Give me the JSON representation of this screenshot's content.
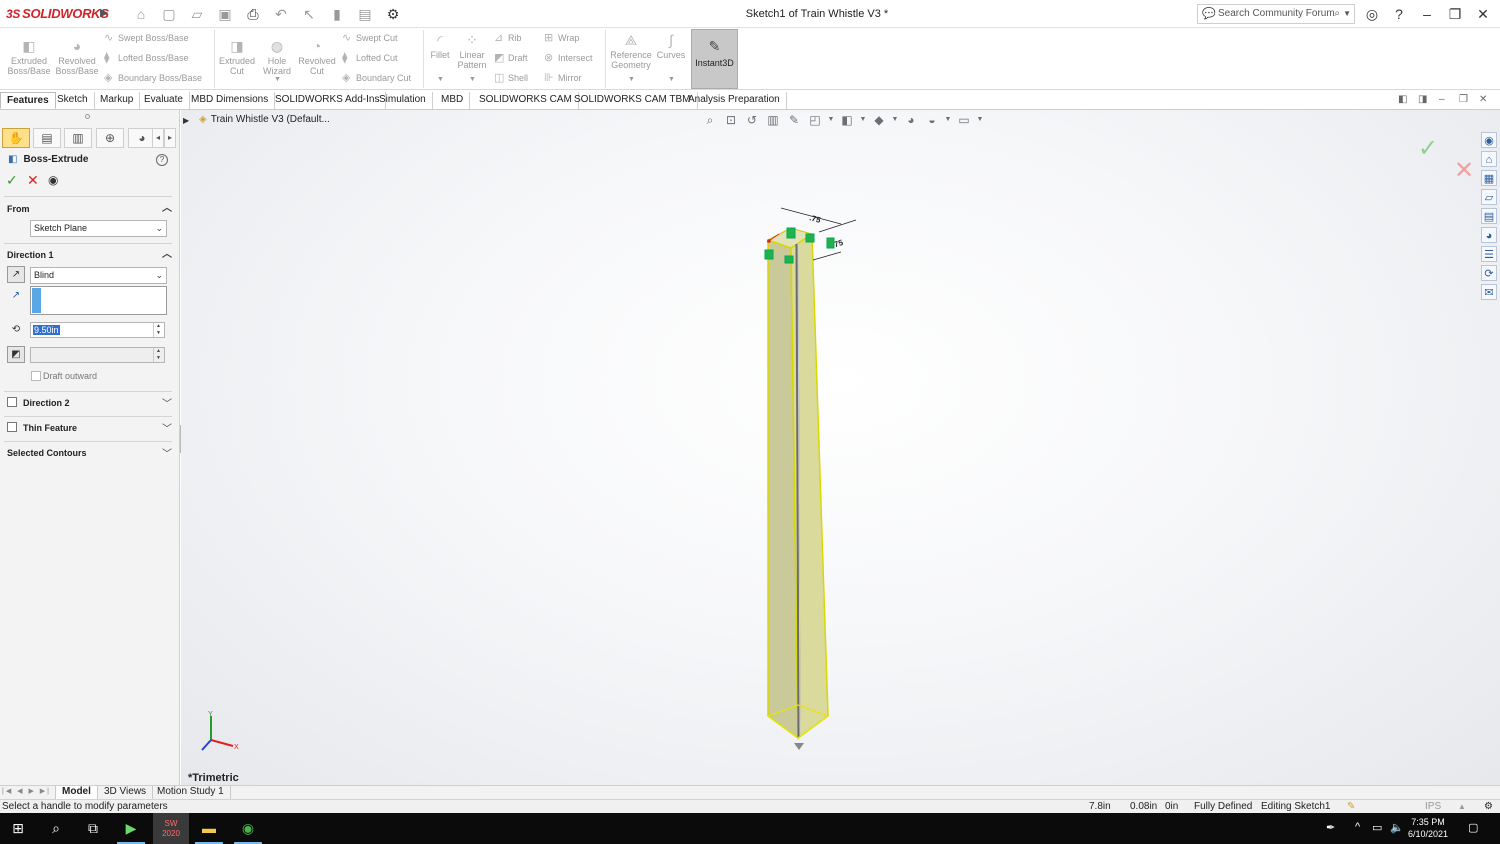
{
  "app": {
    "logo_ds": "3S",
    "logo_text": "SOLIDWORKS",
    "title": "Sketch1 of Train Whistle V3 *",
    "search_placeholder": "Search Community Forum"
  },
  "command_manager": {
    "extruded_boss": "Extruded Boss/Base",
    "revolved_boss": "Revolved Boss/Base",
    "swept_boss": "Swept Boss/Base",
    "lofted_boss": "Lofted Boss/Base",
    "boundary_boss": "Boundary Boss/Base",
    "extruded_cut": "Extruded Cut",
    "hole_wizard": "Hole Wizard",
    "revolved_cut": "Revolved Cut",
    "swept_cut": "Swept Cut",
    "lofted_cut": "Lofted Cut",
    "boundary_cut": "Boundary Cut",
    "fillet": "Fillet",
    "linear_pattern": "Linear Pattern",
    "rib": "Rib",
    "draft": "Draft",
    "shell": "Shell",
    "wrap": "Wrap",
    "intersect": "Intersect",
    "mirror": "Mirror",
    "reference_geometry": "Reference Geometry",
    "curves": "Curves",
    "instant3d": "Instant3D"
  },
  "tabs": [
    "Features",
    "Sketch",
    "Markup",
    "Evaluate",
    "MBD Dimensions",
    "SOLIDWORKS Add-Ins",
    "Simulation",
    "MBD",
    "SOLIDWORKS CAM",
    "SOLIDWORKS CAM TBM",
    "Analysis Preparation"
  ],
  "property_manager": {
    "title": "Boss-Extrude",
    "help": "?",
    "from_label": "From",
    "from_value": "Sketch Plane",
    "direction1_label": "Direction 1",
    "end_condition": "Blind",
    "depth_value": "9.50in",
    "draft_outward": "Draft outward",
    "direction2_label": "Direction 2",
    "thin_feature_label": "Thin Feature",
    "selected_contours_label": "Selected Contours"
  },
  "viewport": {
    "tree_item": "Train Whistle V3  (Default...",
    "view_name": "*Trimetric",
    "dim_top": ".75",
    "dim_side": ".75",
    "triad_y": "Y",
    "triad_x": "X"
  },
  "bottom_tabs": [
    "Model",
    "3D Views",
    "Motion Study 1"
  ],
  "status": {
    "message": "Select a handle to modify parameters",
    "x": "7.8in",
    "y": "0.08in",
    "z": "0in",
    "sketch_state": "Fully Defined",
    "editing": "Editing Sketch1",
    "units": "IPS"
  },
  "taskbar": {
    "sw_label": "SW\n2020",
    "time": "7:35 PM",
    "date": "6/10/2021"
  },
  "colors": {
    "accent_red": "#d2232a",
    "model_fill": "#d9d9a0",
    "model_edge": "#e6e600",
    "handle_green": "#22b14c"
  }
}
